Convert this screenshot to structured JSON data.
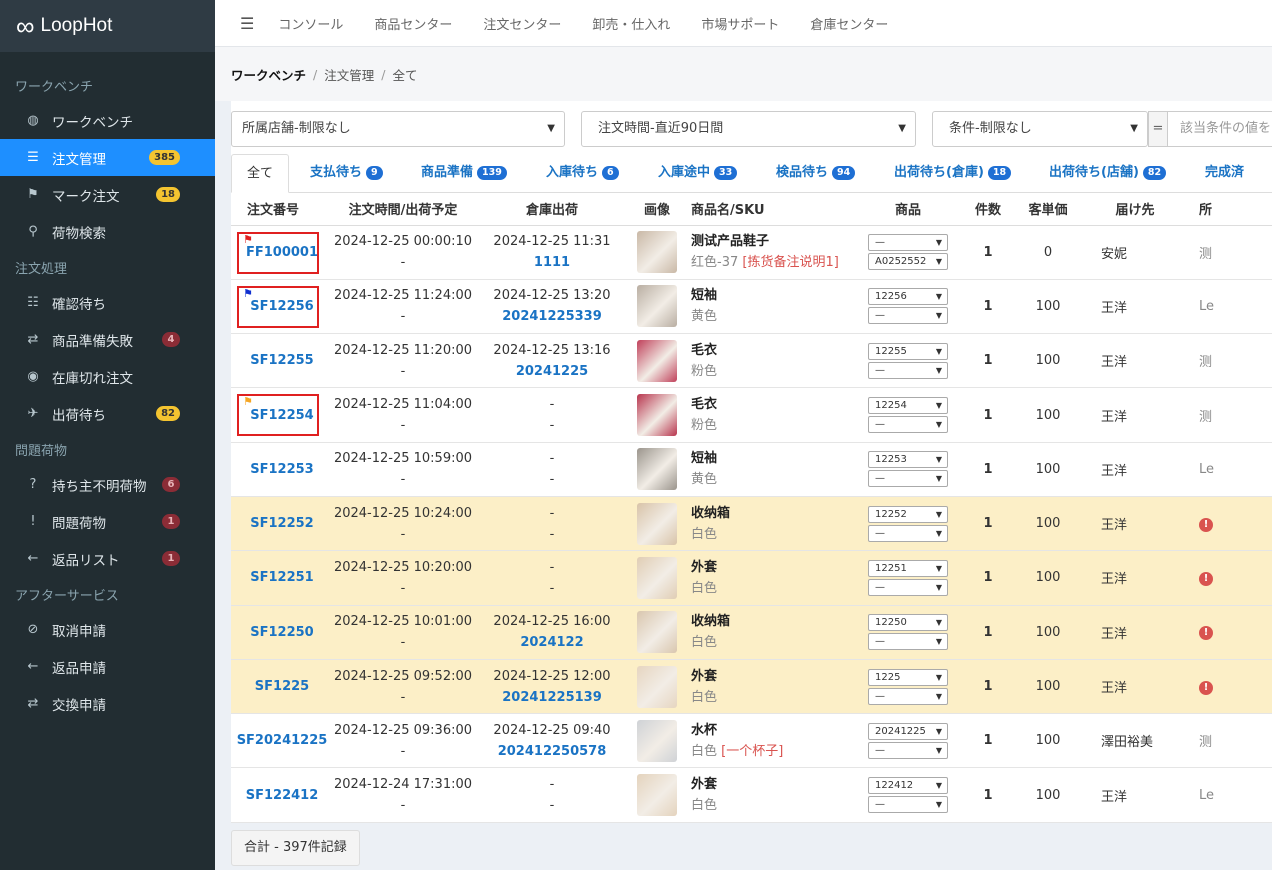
{
  "app": {
    "logo_mark": "∞",
    "name": "LoopHot"
  },
  "sidebar": {
    "sections": [
      {
        "title": "ワークベンチ",
        "items": [
          {
            "icon": "dashboard-icon",
            "glyph": "◍",
            "label": "ワークベンチ",
            "badge": ""
          },
          {
            "icon": "list-icon",
            "glyph": "☰",
            "label": "注文管理",
            "badge": "385",
            "active": true
          },
          {
            "icon": "flag-icon",
            "glyph": "⚑",
            "label": "マーク注文",
            "badge": "18"
          },
          {
            "icon": "search-icon",
            "glyph": "⚲",
            "label": "荷物検索",
            "badge": ""
          }
        ]
      },
      {
        "title": "注文処理",
        "items": [
          {
            "icon": "checklist-icon",
            "glyph": "☷",
            "label": "確認待ち",
            "badge": ""
          },
          {
            "icon": "retry-icon",
            "glyph": "⇄",
            "label": "商品準備失敗",
            "badge": "4"
          },
          {
            "icon": "circle-icon",
            "glyph": "◉",
            "label": "在庫切れ注文",
            "badge": ""
          },
          {
            "icon": "plane-icon",
            "glyph": "✈",
            "label": "出荷待ち",
            "badge": "82"
          }
        ]
      },
      {
        "title": "問題荷物",
        "items": [
          {
            "icon": "question-icon",
            "glyph": "?",
            "label": "持ち主不明荷物",
            "badge": "6"
          },
          {
            "icon": "alert-icon",
            "glyph": "!",
            "label": "問題荷物",
            "badge": "1"
          },
          {
            "icon": "arrow-left-icon",
            "glyph": "←",
            "label": "返品リスト",
            "badge": "1"
          }
        ]
      },
      {
        "title": "アフターサービス",
        "items": [
          {
            "icon": "ban-icon",
            "glyph": "⊘",
            "label": "取消申請",
            "badge": ""
          },
          {
            "icon": "arrow-left-icon",
            "glyph": "←",
            "label": "返品申請",
            "badge": ""
          },
          {
            "icon": "exchange-icon",
            "glyph": "⇄",
            "label": "交換申請",
            "badge": ""
          }
        ]
      }
    ]
  },
  "topnav": {
    "menu_glyph": "☰",
    "items": [
      "コンソール",
      "商品センター",
      "注文センター",
      "卸売・仕入れ",
      "市場サポート",
      "倉庫センター"
    ]
  },
  "breadcrumb": {
    "root": "ワークベンチ",
    "mid": "注文管理",
    "leaf": "全て",
    "sep": "/"
  },
  "filters": {
    "shop": "所属店舗-制限なし",
    "time": "注文時間-直近90日間",
    "cond": "条件-制限なし",
    "eq": "=",
    "value_placeholder": "該当条件の値を"
  },
  "tabs": [
    {
      "label": "全て",
      "count": ""
    },
    {
      "label": "支払待ち",
      "count": "9"
    },
    {
      "label": "商品準備",
      "count": "139"
    },
    {
      "label": "入庫待ち",
      "count": "6"
    },
    {
      "label": "入庫途中",
      "count": "33"
    },
    {
      "label": "検品待ち",
      "count": "94"
    },
    {
      "label": "出荷待ち(倉庫)",
      "count": "18"
    },
    {
      "label": "出荷待ち(店舗)",
      "count": "82"
    },
    {
      "label": "完成済",
      "count": ""
    }
  ],
  "table": {
    "headers": [
      "注文番号",
      "注文時間/出荷予定",
      "倉庫出荷",
      "画像",
      "商品名/SKU",
      "商品",
      "件数",
      "客単価",
      "届け先",
      "所"
    ],
    "rows": [
      {
        "no": "FF100001",
        "flag": "red",
        "t1": "2024-12-25 00:00:10",
        "t2": "-",
        "w1": "2024-12-25 11:31",
        "w2": "1111",
        "name": "测试产品鞋子",
        "sku": "红色-37",
        "note": "[拣货备注说明1]",
        "sel1": "—",
        "sel2": "A0252552",
        "qty": "1",
        "price": "0",
        "dest": "安妮",
        "extra": "测",
        "hl": false,
        "img": "#c9b8a6"
      },
      {
        "no": "SF12256",
        "flag": "blue",
        "t1": "2024-12-25 11:24:00",
        "t2": "-",
        "w1": "2024-12-25 13:20",
        "w2": "20241225339",
        "name": "短袖",
        "sku": "黄色",
        "note": "",
        "sel1": "12256",
        "sel2": "—",
        "qty": "1",
        "price": "100",
        "dest": "王洋",
        "extra": "Le",
        "hl": false,
        "img": "#b9aea2"
      },
      {
        "no": "SF12255",
        "flag": "",
        "t1": "2024-12-25 11:20:00",
        "t2": "-",
        "w1": "2024-12-25 13:16",
        "w2": "20241225",
        "name": "毛衣",
        "sku": "粉色",
        "note": "",
        "sel1": "12255",
        "sel2": "—",
        "qty": "1",
        "price": "100",
        "dest": "王洋",
        "extra": "测",
        "hl": false,
        "img": "#c0405a"
      },
      {
        "no": "SF12254",
        "flag": "orange",
        "t1": "2024-12-25 11:04:00",
        "t2": "-",
        "w1": "-",
        "w2": "-",
        "name": "毛衣",
        "sku": "粉色",
        "note": "",
        "sel1": "12254",
        "sel2": "—",
        "qty": "1",
        "price": "100",
        "dest": "王洋",
        "extra": "测",
        "hl": false,
        "img": "#b8354e"
      },
      {
        "no": "SF12253",
        "flag": "",
        "t1": "2024-12-25 10:59:00",
        "t2": "-",
        "w1": "-",
        "w2": "-",
        "name": "短袖",
        "sku": "黄色",
        "note": "",
        "sel1": "12253",
        "sel2": "—",
        "qty": "1",
        "price": "100",
        "dest": "王洋",
        "extra": "Le",
        "hl": false,
        "img": "#9a948c"
      },
      {
        "no": "SF12252",
        "flag": "",
        "t1": "2024-12-25 10:24:00",
        "t2": "-",
        "w1": "-",
        "w2": "-",
        "name": "收纳箱",
        "sku": "白色",
        "note": "",
        "sel1": "12252",
        "sel2": "—",
        "qty": "1",
        "price": "100",
        "dest": "王洋",
        "extra": "!",
        "hl": true,
        "img": "#d8c3a8"
      },
      {
        "no": "SF12251",
        "flag": "",
        "t1": "2024-12-25 10:20:00",
        "t2": "-",
        "w1": "-",
        "w2": "-",
        "name": "外套",
        "sku": "白色",
        "note": "",
        "sel1": "12251",
        "sel2": "—",
        "qty": "1",
        "price": "100",
        "dest": "王洋",
        "extra": "!",
        "hl": true,
        "img": "#e0cdb4"
      },
      {
        "no": "SF12250",
        "flag": "",
        "t1": "2024-12-25 10:01:00",
        "t2": "-",
        "w1": "2024-12-25 16:00",
        "w2": "2024122",
        "name": "收纳箱",
        "sku": "白色",
        "note": "",
        "sel1": "12250",
        "sel2": "—",
        "qty": "1",
        "price": "100",
        "dest": "王洋",
        "extra": "!",
        "hl": true,
        "img": "#d9c6ae"
      },
      {
        "no": "SF1225",
        "flag": "",
        "t1": "2024-12-25 09:52:00",
        "t2": "-",
        "w1": "2024-12-25 12:00",
        "w2": "20241225139",
        "name": "外套",
        "sku": "白色",
        "note": "",
        "sel1": "1225",
        "sel2": "—",
        "qty": "1",
        "price": "100",
        "dest": "王洋",
        "extra": "!",
        "hl": true,
        "img": "#e6d5c0"
      },
      {
        "no": "SF20241225",
        "flag": "",
        "t1": "2024-12-25 09:36:00",
        "t2": "-",
        "w1": "2024-12-25 09:40",
        "w2": "202412250578",
        "name": "水杯",
        "sku": "白色",
        "note": "[一个杯子]",
        "sel1": "20241225",
        "sel2": "—",
        "qty": "1",
        "price": "100",
        "dest": "澤田裕美",
        "extra": "测",
        "hl": false,
        "img": "#cfd2d6"
      },
      {
        "no": "SF122412",
        "flag": "",
        "t1": "2024-12-24 17:31:00",
        "t2": "-",
        "w1": "-",
        "w2": "-",
        "name": "外套",
        "sku": "白色",
        "note": "",
        "sel1": "122412",
        "sel2": "—",
        "qty": "1",
        "price": "100",
        "dest": "王洋",
        "extra": "Le",
        "hl": false,
        "img": "#e4d3bd"
      }
    ]
  },
  "footer": {
    "total": "合計 - 397件記録"
  },
  "colors": {
    "accent": "#1e8fff",
    "link": "#1a73c4",
    "highlight": "#fcefc7",
    "flag_red": "#e02020",
    "flag_blue": "#1030d0",
    "flag_orange": "#f5a623"
  }
}
